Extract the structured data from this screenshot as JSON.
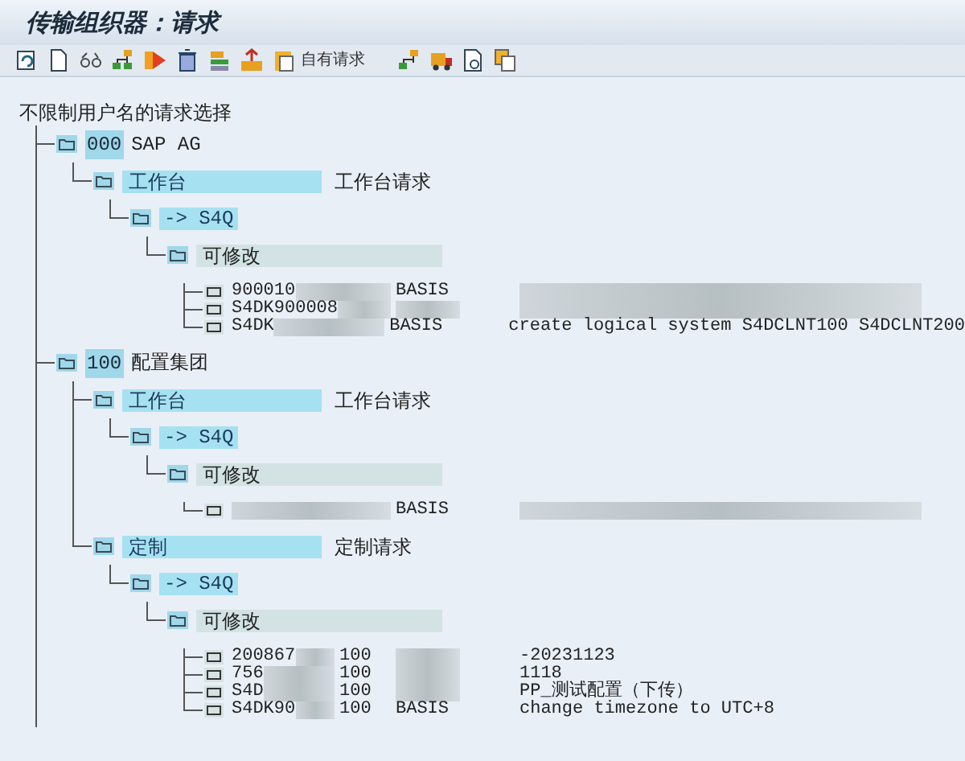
{
  "window": {
    "title": "传输组织器：请求"
  },
  "toolbar": {
    "text_button": "自有请求"
  },
  "tree": {
    "heading": "不限制用户名的请求选择",
    "children": [
      {
        "kind": "client",
        "code": "000",
        "name": "SAP AG",
        "children": [
          {
            "kind": "category",
            "label": "工作台",
            "description": "工作台请求",
            "children": [
              {
                "kind": "target",
                "label": "-> S4Q",
                "children": [
                  {
                    "kind": "status",
                    "label": "可修改",
                    "children": [
                      {
                        "kind": "request",
                        "id": "900010",
                        "owner": "BASIS"
                      },
                      {
                        "kind": "request",
                        "id": "S4DK900008"
                      },
                      {
                        "kind": "request",
                        "id": "S4DK",
                        "owner": "BASIS",
                        "description": "create logical system S4DCLNT100 S4DCLNT200"
                      }
                    ]
                  }
                ]
              }
            ]
          }
        ]
      },
      {
        "kind": "client",
        "code": "100",
        "name": "配置集团",
        "children": [
          {
            "kind": "category",
            "label": "工作台",
            "description": "工作台请求",
            "children": [
              {
                "kind": "target",
                "label": "-> S4Q",
                "children": [
                  {
                    "kind": "status",
                    "label": "可修改",
                    "children": [
                      {
                        "kind": "request",
                        "owner": "BASIS"
                      }
                    ]
                  }
                ]
              }
            ]
          },
          {
            "kind": "category",
            "label": "定制",
            "description": "定制请求",
            "children": [
              {
                "kind": "target",
                "label": "-> S4Q",
                "children": [
                  {
                    "kind": "status",
                    "label": "可修改",
                    "children": [
                      {
                        "kind": "request",
                        "id": "200867",
                        "client": "100",
                        "description": "-20231123"
                      },
                      {
                        "kind": "request",
                        "id": "756",
                        "client": "100",
                        "description": "1118"
                      },
                      {
                        "kind": "request",
                        "id": "S4D",
                        "client": "100",
                        "description": "PP_测试配置（下传）"
                      },
                      {
                        "kind": "request",
                        "id": "S4DK90",
                        "client": "100",
                        "owner": "BASIS",
                        "description": "change timezone to UTC+8"
                      }
                    ]
                  }
                ]
              }
            ]
          }
        ]
      }
    ]
  }
}
